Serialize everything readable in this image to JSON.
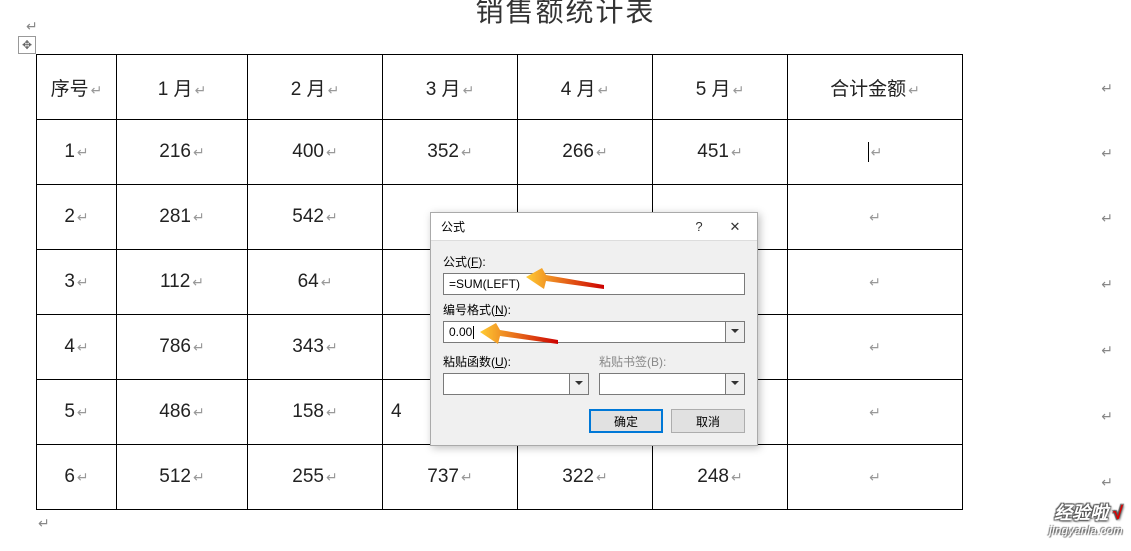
{
  "title": "销售额统计表",
  "table": {
    "headers": [
      "序号",
      "1 月",
      "2 月",
      "3 月",
      "4 月",
      "5 月",
      "合计金额"
    ],
    "rows": [
      {
        "seq": "1",
        "m1": "216",
        "m2": "400",
        "m3": "352",
        "m4": "266",
        "m5": "451",
        "total": ""
      },
      {
        "seq": "2",
        "m1": "281",
        "m2": "542",
        "m3": "",
        "m4": "",
        "m5": "",
        "total": ""
      },
      {
        "seq": "3",
        "m1": "112",
        "m2": "64",
        "m3": "",
        "m4": "",
        "m5": "",
        "total": ""
      },
      {
        "seq": "4",
        "m1": "786",
        "m2": "343",
        "m3": "",
        "m4": "",
        "m5": "",
        "total": ""
      },
      {
        "seq": "5",
        "m1": "486",
        "m2": "158",
        "m3": "4",
        "m4": "",
        "m5": "",
        "total": ""
      },
      {
        "seq": "6",
        "m1": "512",
        "m2": "255",
        "m3": "737",
        "m4": "322",
        "m5": "248",
        "total": ""
      }
    ]
  },
  "dialog": {
    "title": "公式",
    "help": "?",
    "close": "✕",
    "formula_label": "公式(F):",
    "formula_value": "=SUM(LEFT)",
    "format_label": "编号格式(N):",
    "format_value": "0.00",
    "paste_fn_label": "粘贴函数(U):",
    "paste_bm_label": "粘贴书签(B):",
    "ok": "确定",
    "cancel": "取消"
  },
  "watermark": {
    "line1": "经验啦",
    "check": "√",
    "line2": "jingyanla.com"
  }
}
